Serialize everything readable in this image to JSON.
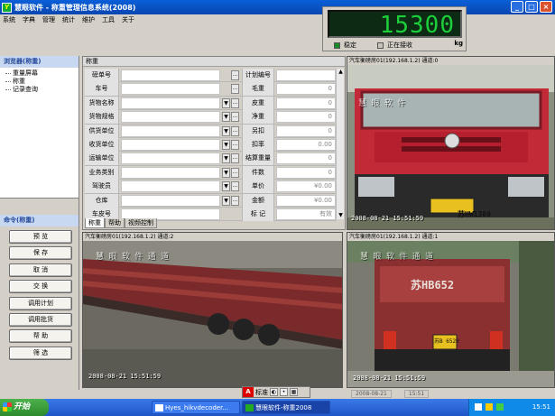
{
  "window": {
    "title": "慧眼软件 - 称重管理信息系统(2008)",
    "app_icon": "Y",
    "controls": {
      "minimize": "_",
      "maximize": "□",
      "close": "×"
    }
  },
  "menu": [
    "系统",
    "字典",
    "管理",
    "统计",
    "维护",
    "工具",
    "关于"
  ],
  "weight": {
    "value": "15300",
    "unit": "kg",
    "stable_label": "稳定",
    "receiving_label": "正在接收",
    "led_color": "#1ccf3a"
  },
  "left_panel": {
    "nav_header": "浏览器(称重)",
    "nav_items": [
      "重量屏幕",
      "称重",
      "记录查询"
    ],
    "cmd_header": "命令(称重)",
    "commands": [
      "预 览",
      "保 存",
      "取 消",
      "交 换",
      "调用计划",
      "调用批货",
      "帮 助",
      "筛 选"
    ]
  },
  "form": {
    "title": "称重",
    "rows": [
      {
        "label": "磅单号",
        "value": "",
        "label2": "计划编号",
        "value2": ""
      },
      {
        "label": "车号",
        "value": "",
        "label2": "毛重",
        "value2": "0"
      },
      {
        "label": "货物名称",
        "value": "",
        "label2": "皮重",
        "value2": "0"
      },
      {
        "label": "货物规格",
        "value": "",
        "label2": "净重",
        "value2": "0"
      },
      {
        "label": "供货单位",
        "value": "",
        "label2": "另扣",
        "value2": "0"
      },
      {
        "label": "收货单位",
        "value": "",
        "label2": "扣率",
        "value2": "0.00"
      },
      {
        "label": "运输单位",
        "value": "",
        "label2": "结算重量",
        "value2": "0"
      },
      {
        "label": "业务类别",
        "value": "",
        "label2": "件数",
        "value2": "0"
      },
      {
        "label": "驾驶员",
        "value": "",
        "label2": "单价",
        "value2": "¥0.00"
      },
      {
        "label": "仓库",
        "value": "",
        "label2": "金额",
        "value2": "¥0.00"
      },
      {
        "label": "车皮号",
        "value": "",
        "label2": "标 记",
        "value2": "有效"
      }
    ],
    "tabs": [
      "称重",
      "帮助",
      "视频控制"
    ]
  },
  "cameras": [
    {
      "caption": "汽车衡磅房01(192.168.1.2) 通道:0",
      "osd_time": "2008-08-21 15:51:59",
      "plate": "苏HW1380",
      "watermark": "慧 眼 软 件"
    },
    {
      "caption": "汽车衡磅房01(192.168.1.2) 通道:2",
      "osd_time": "2008-08-21 15:51:59",
      "watermark": "慧 眼 软 件 通 道"
    },
    {
      "caption": "汽车衡磅房01(192.168.1.2) 通道:1",
      "osd_time": "2008-08-21 15:51:59",
      "plate": "苏HB652",
      "plate_small": "苏B 652H",
      "watermark": "慧 眼 软 件 通 道"
    }
  ],
  "ime": {
    "mode": "标准",
    "icon_a": "A"
  },
  "status_bar": [
    "2008-08-21",
    "15:51"
  ],
  "taskbar": {
    "start": "开始",
    "tasks": [
      "Hyes_hikvdecoder...",
      "慧眼软件-称重2008"
    ],
    "clock": "15:51"
  }
}
